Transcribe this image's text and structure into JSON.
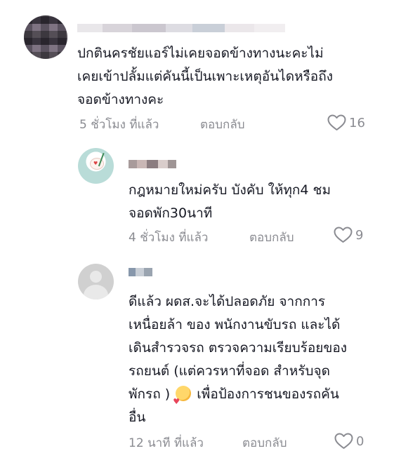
{
  "comments": [
    {
      "lines": [
        "ปกตินครชัยแอร์ไม่เคยจอดข้างทางนะคะไม่",
        "เคยเข้าปลั้มแต่คันนี้เป็นเพาะเหตุอันไดหรือถึง",
        "จอดข้างทางคะ"
      ],
      "time": "5 ชั่วโมง ที่แล้ว",
      "reply": "ตอบกลับ",
      "likes": "16"
    },
    {
      "lines": [
        "กฎหมายใหม่ครับ บังคับ ให้ทุก4 ชม",
        "จอดพัก30นาที"
      ],
      "time": "4 ชั่วโมง ที่แล้ว",
      "reply": "ตอบกลับ",
      "likes": "9"
    },
    {
      "lines": [
        "ดีแล้ว ผดส.จะได้ปลอดภัย จากการ",
        "เหนื่อยล้า ของ พนักงานขับรถ และได้",
        "เดินสำรวจรถ ตรวจความเรียบร้อยของ",
        "รถยนต์ (แต่ควรหาที่จอด สำหรับจุด",
        "พักรถ )",
        "เพื่อป้องการชนของรถคัน",
        "อื่น"
      ],
      "time": "12 นาที ที่แล้ว",
      "reply": "ตอบกลับ",
      "likes": "0"
    }
  ],
  "icons": {
    "like": "heart-outline-icon",
    "emoji": "smiling-face-with-hearts-emoji"
  },
  "colors": {
    "text": "#161823",
    "meta": "#8a8b91"
  }
}
